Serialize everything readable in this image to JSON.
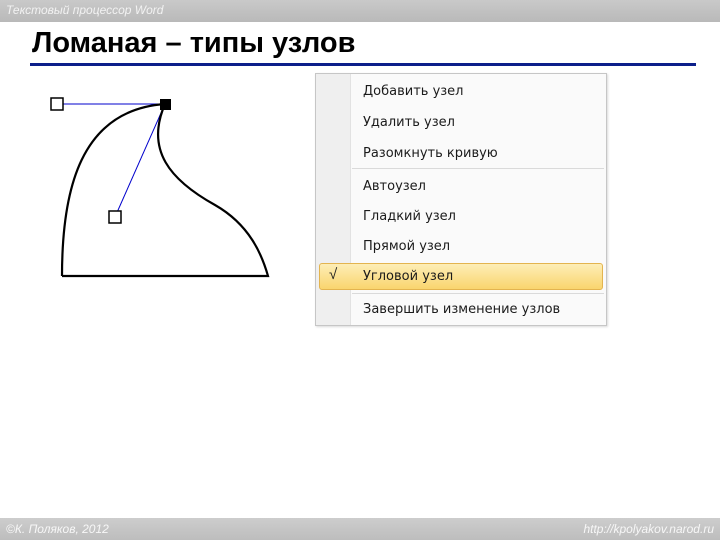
{
  "header": {
    "course_title": "Текстовый процессор Word"
  },
  "slide": {
    "title": "Ломаная – типы узлов"
  },
  "diagram": {
    "description_icon": "curve-node-handles-icon"
  },
  "context_menu": {
    "items": [
      {
        "label": "Добавить узел"
      },
      {
        "label": "Удалить узел"
      },
      {
        "label": "Разомкнуть кривую"
      },
      {
        "label": "Автоузел"
      },
      {
        "label": "Гладкий узел"
      },
      {
        "label": "Прямой узел"
      },
      {
        "label": "Угловой узел",
        "checked": true
      },
      {
        "label": "Завершить изменение узлов"
      }
    ],
    "check_mark": "√",
    "highlight_color": "#f9d56e"
  },
  "footer": {
    "author": "©К. Поляков, 2012",
    "url": "http://kpolyakov.narod.ru"
  },
  "colors": {
    "title_rule": "#0c1f8a",
    "bars": "#c4c4c4",
    "handle_line": "#0000cc"
  }
}
